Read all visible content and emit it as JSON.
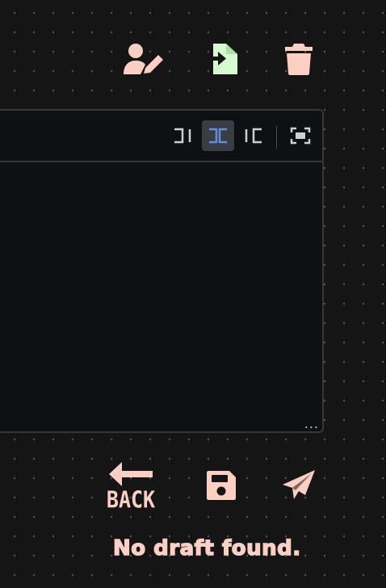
{
  "top_actions": {
    "edit_author_icon": "user-pen-icon",
    "import_icon": "file-import-icon",
    "delete_icon": "trash-icon"
  },
  "editor": {
    "toolbar": {
      "edit_mode_icon": "edit-mode-icon",
      "live_mode_icon": "live-mode-icon",
      "preview_mode_icon": "preview-mode-icon",
      "fullscreen_icon": "fullscreen-icon",
      "active_mode": "live"
    },
    "resize_handle": "..."
  },
  "bottom_actions": {
    "back_label": "BACK",
    "back_icon": "arrow-left-icon",
    "save_icon": "floppy-disk-icon",
    "send_icon": "paper-plane-icon"
  },
  "status": {
    "message": "No draft found."
  },
  "colors": {
    "background": "#151515",
    "accent": "#fccfc3",
    "import_accent": "#d6fad0",
    "active_tab": "#3a3d44",
    "active_icon": "#5b8fe0",
    "editor_bg": "#0e1014",
    "editor_border": "#34373d"
  }
}
